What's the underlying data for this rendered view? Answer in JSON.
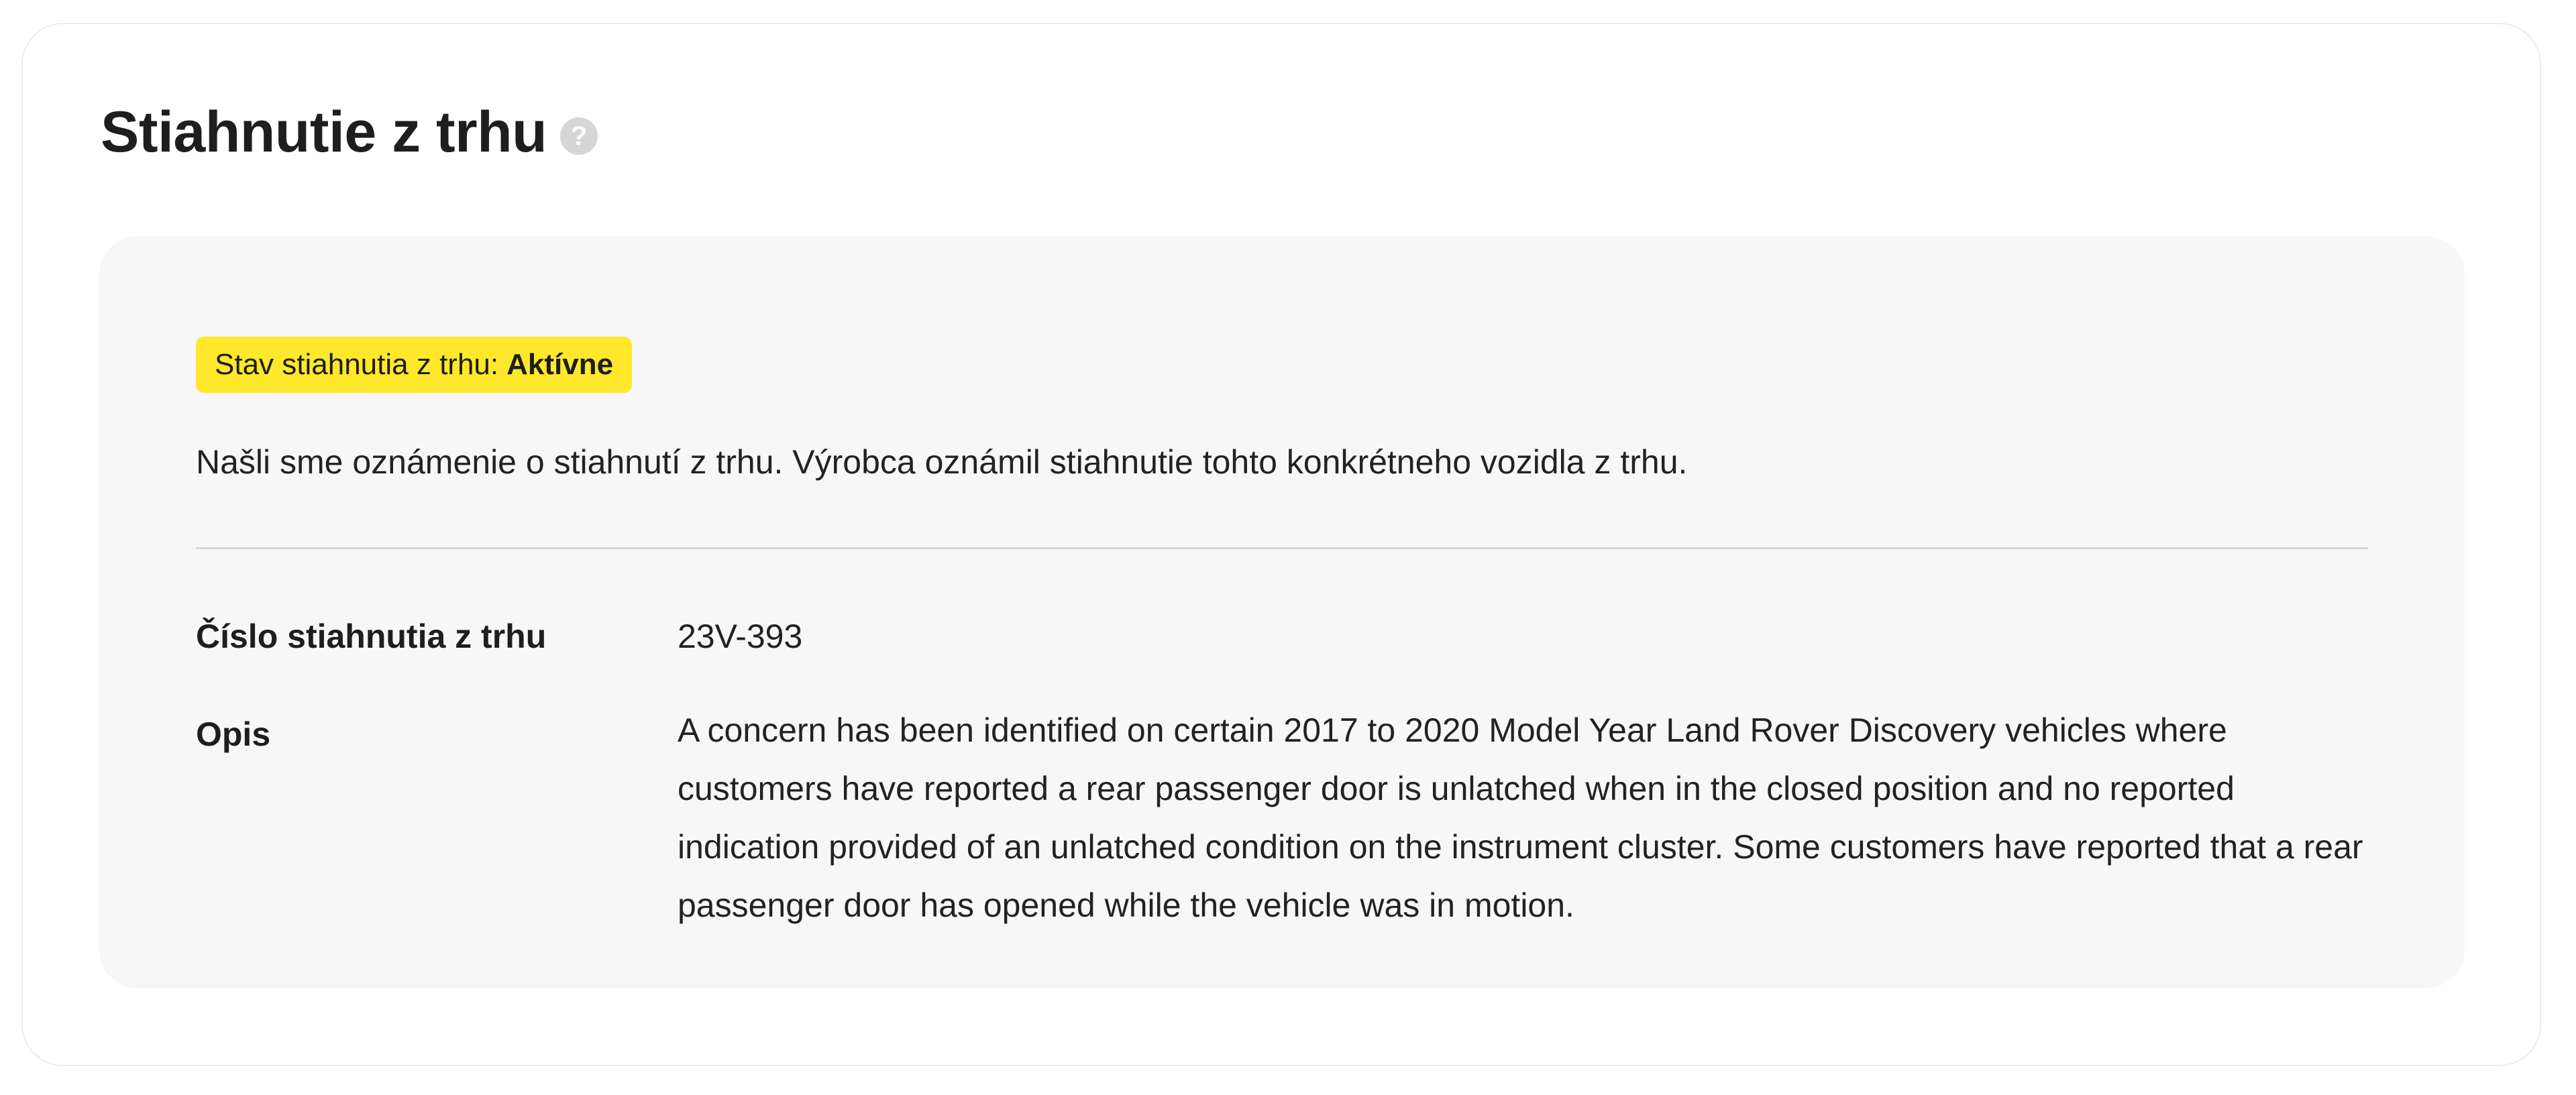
{
  "header": {
    "title": "Stiahnutie z trhu",
    "help_icon": "question-mark-icon",
    "help_glyph": "?"
  },
  "recall": {
    "status_label": "Stav stiahnutia z trhu:",
    "status_value": "Aktívne",
    "status_color": "#ffe82b",
    "notice": "Našli sme oznámenie o stiahnutí z trhu. Výrobca oznámil stiahnutie tohto konkrétneho vozidla z trhu.",
    "details": {
      "recall_number_label": "Číslo stiahnutia z trhu",
      "recall_number_value": "23V-393",
      "description_label": "Opis",
      "description_value": "A concern has been identified on certain 2017 to 2020 Model Year Land Rover Discovery vehicles where customers have reported a rear passenger door is unlatched when in the closed position and no reported indication provided of an unlatched condition on the instrument cluster. Some customers have reported that a rear passenger door has opened while the vehicle was in motion."
    }
  }
}
